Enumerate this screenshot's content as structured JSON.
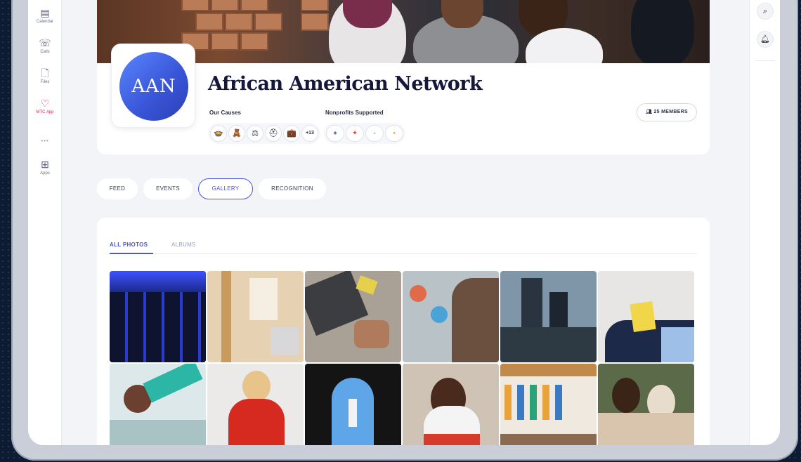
{
  "left_nav": {
    "items": [
      {
        "label": "Calendar",
        "icon": "calendar-icon"
      },
      {
        "label": "Calls",
        "icon": "phone-icon"
      },
      {
        "label": "Files",
        "icon": "file-icon"
      },
      {
        "label": "MTC App",
        "icon": "heart-icon"
      },
      {
        "label": "•••",
        "icon": "more-icon"
      },
      {
        "label": "Apps",
        "icon": "plus-square-icon"
      }
    ]
  },
  "right_rail": {
    "icons": [
      "search-icon",
      "bell-icon"
    ]
  },
  "profile": {
    "logo_text": "AAN",
    "title": "African American Network",
    "our_causes_label": "Our Causes",
    "nonprofits_label": "Nonprofits Supported",
    "more_causes": "+13",
    "members_label": "25 MEMBERS"
  },
  "tabs": [
    {
      "label": "FEED"
    },
    {
      "label": "EVENTS"
    },
    {
      "label": "GALLERY",
      "active": true
    },
    {
      "label": "RECOGNITION"
    }
  ],
  "gallery": {
    "subtabs": [
      {
        "label": "ALL PHOTOS",
        "active": true
      },
      {
        "label": "ALBUMS"
      }
    ]
  },
  "colors": {
    "accent": "#4a57d6",
    "active_nav": "#e0245e",
    "page_bg": "#f3f4f8"
  }
}
